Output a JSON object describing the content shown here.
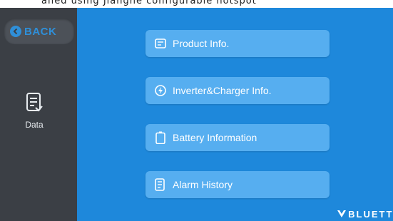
{
  "top_strip": {
    "text": "alled using Jianghe configurable hotspot"
  },
  "sidebar": {
    "back_label": "BACK",
    "data_label": "Data"
  },
  "menu": {
    "items": [
      {
        "label": "Product Info.",
        "icon": "info-card-icon"
      },
      {
        "label": "Inverter&Charger Info.",
        "icon": "lightning-icon"
      },
      {
        "label": "Battery Information",
        "icon": "battery-icon"
      },
      {
        "label": "Alarm History",
        "icon": "history-list-icon"
      }
    ]
  },
  "brand": {
    "logo_text": "BLUETTI"
  },
  "colors": {
    "sidebar": "#3b3f45",
    "main_bg": "#1e88db",
    "button_bg": "#56aef0",
    "accent": "#2f8fd8"
  }
}
